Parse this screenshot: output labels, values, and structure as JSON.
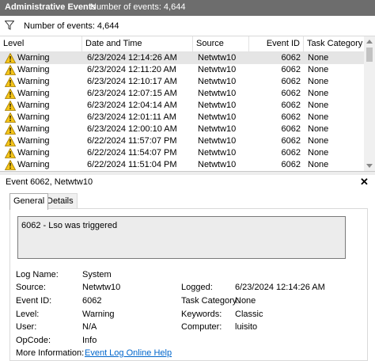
{
  "topbar": {
    "title": "Administrative Events",
    "count_label": "Number of events: 4,644"
  },
  "filter": {
    "text": "Number of events: 4,644"
  },
  "columns": [
    "Level",
    "Date and Time",
    "Source",
    "Event ID",
    "Task Category"
  ],
  "rows": [
    {
      "level": "Warning",
      "datetime": "6/23/2024 12:14:26 AM",
      "source": "Netwtw10",
      "event_id": "6062",
      "category": "None"
    },
    {
      "level": "Warning",
      "datetime": "6/23/2024 12:11:20 AM",
      "source": "Netwtw10",
      "event_id": "6062",
      "category": "None"
    },
    {
      "level": "Warning",
      "datetime": "6/23/2024 12:10:17 AM",
      "source": "Netwtw10",
      "event_id": "6062",
      "category": "None"
    },
    {
      "level": "Warning",
      "datetime": "6/23/2024 12:07:15 AM",
      "source": "Netwtw10",
      "event_id": "6062",
      "category": "None"
    },
    {
      "level": "Warning",
      "datetime": "6/23/2024 12:04:14 AM",
      "source": "Netwtw10",
      "event_id": "6062",
      "category": "None"
    },
    {
      "level": "Warning",
      "datetime": "6/23/2024 12:01:11 AM",
      "source": "Netwtw10",
      "event_id": "6062",
      "category": "None"
    },
    {
      "level": "Warning",
      "datetime": "6/23/2024 12:00:10 AM",
      "source": "Netwtw10",
      "event_id": "6062",
      "category": "None"
    },
    {
      "level": "Warning",
      "datetime": "6/22/2024 11:57:07 PM",
      "source": "Netwtw10",
      "event_id": "6062",
      "category": "None"
    },
    {
      "level": "Warning",
      "datetime": "6/22/2024 11:54:07 PM",
      "source": "Netwtw10",
      "event_id": "6062",
      "category": "None"
    },
    {
      "level": "Warning",
      "datetime": "6/22/2024 11:51:04 PM",
      "source": "Netwtw10",
      "event_id": "6062",
      "category": "None"
    }
  ],
  "details": {
    "header": "Event 6062, Netwtw10",
    "close": "✕",
    "tabs": [
      "General",
      "Details"
    ],
    "description": "6062 - Lso was triggered",
    "fields": {
      "log_name_label": "Log Name:",
      "log_name": "System",
      "source_label": "Source:",
      "source": "Netwtw10",
      "logged_label": "Logged:",
      "logged": "6/23/2024 12:14:26 AM",
      "event_id_label": "Event ID:",
      "event_id": "6062",
      "task_category_label": "Task Category:",
      "task_category": "None",
      "level_label": "Level:",
      "level": "Warning",
      "keywords_label": "Keywords:",
      "keywords": "Classic",
      "user_label": "User:",
      "user": "N/A",
      "computer_label": "Computer:",
      "computer": "luisito",
      "opcode_label": "OpCode:",
      "opcode": "Info",
      "more_info_label": "More Information:",
      "more_info_link": "Event Log Online Help"
    }
  },
  "colors": {
    "topbar": "#6d6d6d",
    "selected_row": "#e5e5e5",
    "link": "#0066cc",
    "warning": "#f5c518"
  },
  "icons": {
    "filter": "filter-icon",
    "warning": "warning-icon",
    "close": "close-icon"
  }
}
